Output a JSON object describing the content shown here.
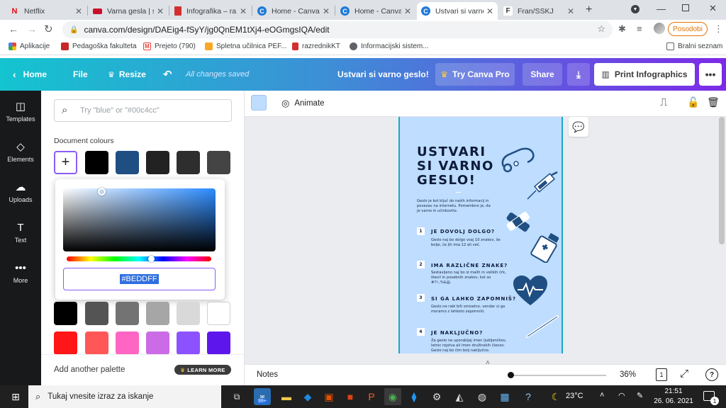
{
  "browser": {
    "tabs": [
      {
        "title": "Netflix",
        "fav": "N",
        "favcolor": "#e50914"
      },
      {
        "title": "Varna gesla | sa",
        "fav": "",
        "favcolor": "#c8102e"
      },
      {
        "title": "Infografika – ra",
        "fav": "",
        "favcolor": "#d32f2f"
      },
      {
        "title": "Home - Canva",
        "fav": "C",
        "favcolor": "#1f7ad6"
      },
      {
        "title": "Home - Canva",
        "fav": "C",
        "favcolor": "#1f7ad6"
      },
      {
        "title": "Ustvari si varno",
        "fav": "C",
        "favcolor": "#1f7ad6"
      },
      {
        "title": "Fran/SSKJ",
        "fav": "F",
        "favcolor": "#6b6b6b"
      }
    ],
    "url": "canva.com/design/DAEig4-fSyY/jg0QnEM1tXj4-eOGmgsIQA/edit",
    "profile_button": "Posodobi",
    "bookmarks": [
      {
        "label": "Aplikacije",
        "color": "#4285f4"
      },
      {
        "label": "Pedagoška fakulteta",
        "color": "#c62828"
      },
      {
        "label": "Prejeto (790)",
        "color": "#ea4335"
      },
      {
        "label": "Spletna učilnica PEF...",
        "color": "#f9a825"
      },
      {
        "label": "razrednikKT",
        "color": "#d32f2f"
      },
      {
        "label": "Informacijski sistem...",
        "color": "#5f6368"
      }
    ],
    "reading_list": "Bralni seznam"
  },
  "canva_header": {
    "home": "Home",
    "file": "File",
    "resize": "Resize",
    "saved_status": "All changes saved",
    "design_title": "Ustvari si varno geslo!",
    "try_pro": "Try Canva Pro",
    "share": "Share",
    "print": "Print Infographics"
  },
  "rail": [
    {
      "label": "Templates",
      "icon": "templates-icon"
    },
    {
      "label": "Elements",
      "icon": "elements-icon"
    },
    {
      "label": "Uploads",
      "icon": "uploads-icon"
    },
    {
      "label": "Text",
      "icon": "text-icon"
    },
    {
      "label": "More",
      "icon": "more-icon"
    }
  ],
  "panel": {
    "search_placeholder": "Try \"blue\" or \"#00c4cc\"",
    "document_colours_heading": "Document colours",
    "document_colours": [
      "#000000",
      "#1f4e82",
      "#222222",
      "#2e2e2e",
      "#444444"
    ],
    "hex_value": "#BEDDFF",
    "default_colours_row1": [
      "#000000",
      "#545454",
      "#737373",
      "#a6a6a6",
      "#d9d9d9",
      "#ffffff"
    ],
    "default_colours_row2": [
      "#ff1616",
      "#ff5757",
      "#ff66c4",
      "#cb6ce6",
      "#8c52ff",
      "#5e17eb"
    ],
    "add_palette": "Add another palette",
    "learn_more": "LEARN MORE"
  },
  "context_toolbar": {
    "swatch_color": "#beddff",
    "animate": "Animate"
  },
  "poster": {
    "title_lines": [
      "USTVARI",
      "SI VARNO",
      "GESLO!"
    ],
    "intro": "Geslo je kot ključ do naših informacij in povezav na internetu. Pomembno je, da je varno in učinkovito.",
    "items": [
      {
        "n": "1",
        "heading": "JE DOVOLJ DOLGO?",
        "text": "Geslo naj bo dolgo vsaj 10 znakov, še bolje, če jih ima 12 ali več."
      },
      {
        "n": "2",
        "heading": "IMA RAZLIČNE ZNAKE?",
        "text": "Sestavljeno naj bo iz malih in velikih črk, števil in posebnih znakov, kot so #?!-,%&@."
      },
      {
        "n": "3",
        "heading": "SI GA LAHKO ZAPOMNIŠ?",
        "text": "Geslo ne rabi biti smiselno, vendar si ga moramo z lahkoto zapomniti."
      },
      {
        "n": "4",
        "heading": "JE NAKLJUČNO?",
        "text": "Za geslo ne uporabljaj imen ljubljenčkov, letnic rojstva ali imen družinskih članov. Geslo naj bo čim bolj naključno."
      }
    ]
  },
  "footer": {
    "notes": "Notes",
    "zoom": "36%",
    "page_count": "1",
    "help": "?"
  },
  "taskbar": {
    "search_placeholder": "Tukaj vnesite izraz za iskanje",
    "badge": "99+",
    "weather": "23°C",
    "time": "21:51",
    "date": "26. 06. 2021",
    "notifications": "1"
  }
}
